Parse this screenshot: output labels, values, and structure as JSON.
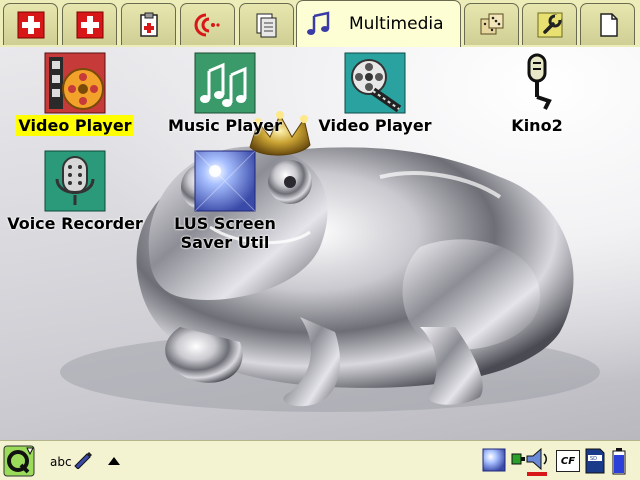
{
  "tabs": [
    {
      "icon": "swiss-cross-icon",
      "label": ""
    },
    {
      "icon": "swiss-cross-icon",
      "label": ""
    },
    {
      "icon": "clipboard-plus-icon",
      "label": ""
    },
    {
      "icon": "wireless-signal-icon",
      "label": ""
    },
    {
      "icon": "document-stack-icon",
      "label": ""
    },
    {
      "icon": "music-note-icon",
      "label": "Multimedia",
      "active": true
    },
    {
      "icon": "dice-icon",
      "label": ""
    },
    {
      "icon": "wrench-icon",
      "label": ""
    },
    {
      "icon": "blank-document-icon",
      "label": ""
    }
  ],
  "launchers": [
    {
      "label": "Video Player",
      "icon": "film-reel-icon",
      "selected": true
    },
    {
      "label": "Music Player",
      "icon": "music-notes-icon"
    },
    {
      "label": "Video Player",
      "icon": "film-strip-icon"
    },
    {
      "label": "Kino2",
      "icon": "microphone-icon"
    },
    {
      "label": "Voice Recorder",
      "icon": "voice-recorder-icon"
    },
    {
      "label": "LUS Screen\nSaver Util",
      "icon": "screensaver-icon"
    }
  ],
  "taskbar": {
    "start_icon": "qtopia-q-icon",
    "input_method": "abc",
    "input_icon": "pencil-icon",
    "menu_icon": "triangle-up-icon",
    "tray": [
      "screensaver-tray-icon",
      "battery-plug-icon",
      "volume-icon",
      "cf-card-icon",
      "sd-card-icon",
      "battery-icon"
    ],
    "cf_label": "CF"
  },
  "colors": {
    "tabbar_bg": "#ecedb8",
    "active_tab_bg": "#fefed4",
    "selected_label_bg": "#ffff00",
    "taskbar_bg": "#f3f3d2"
  }
}
